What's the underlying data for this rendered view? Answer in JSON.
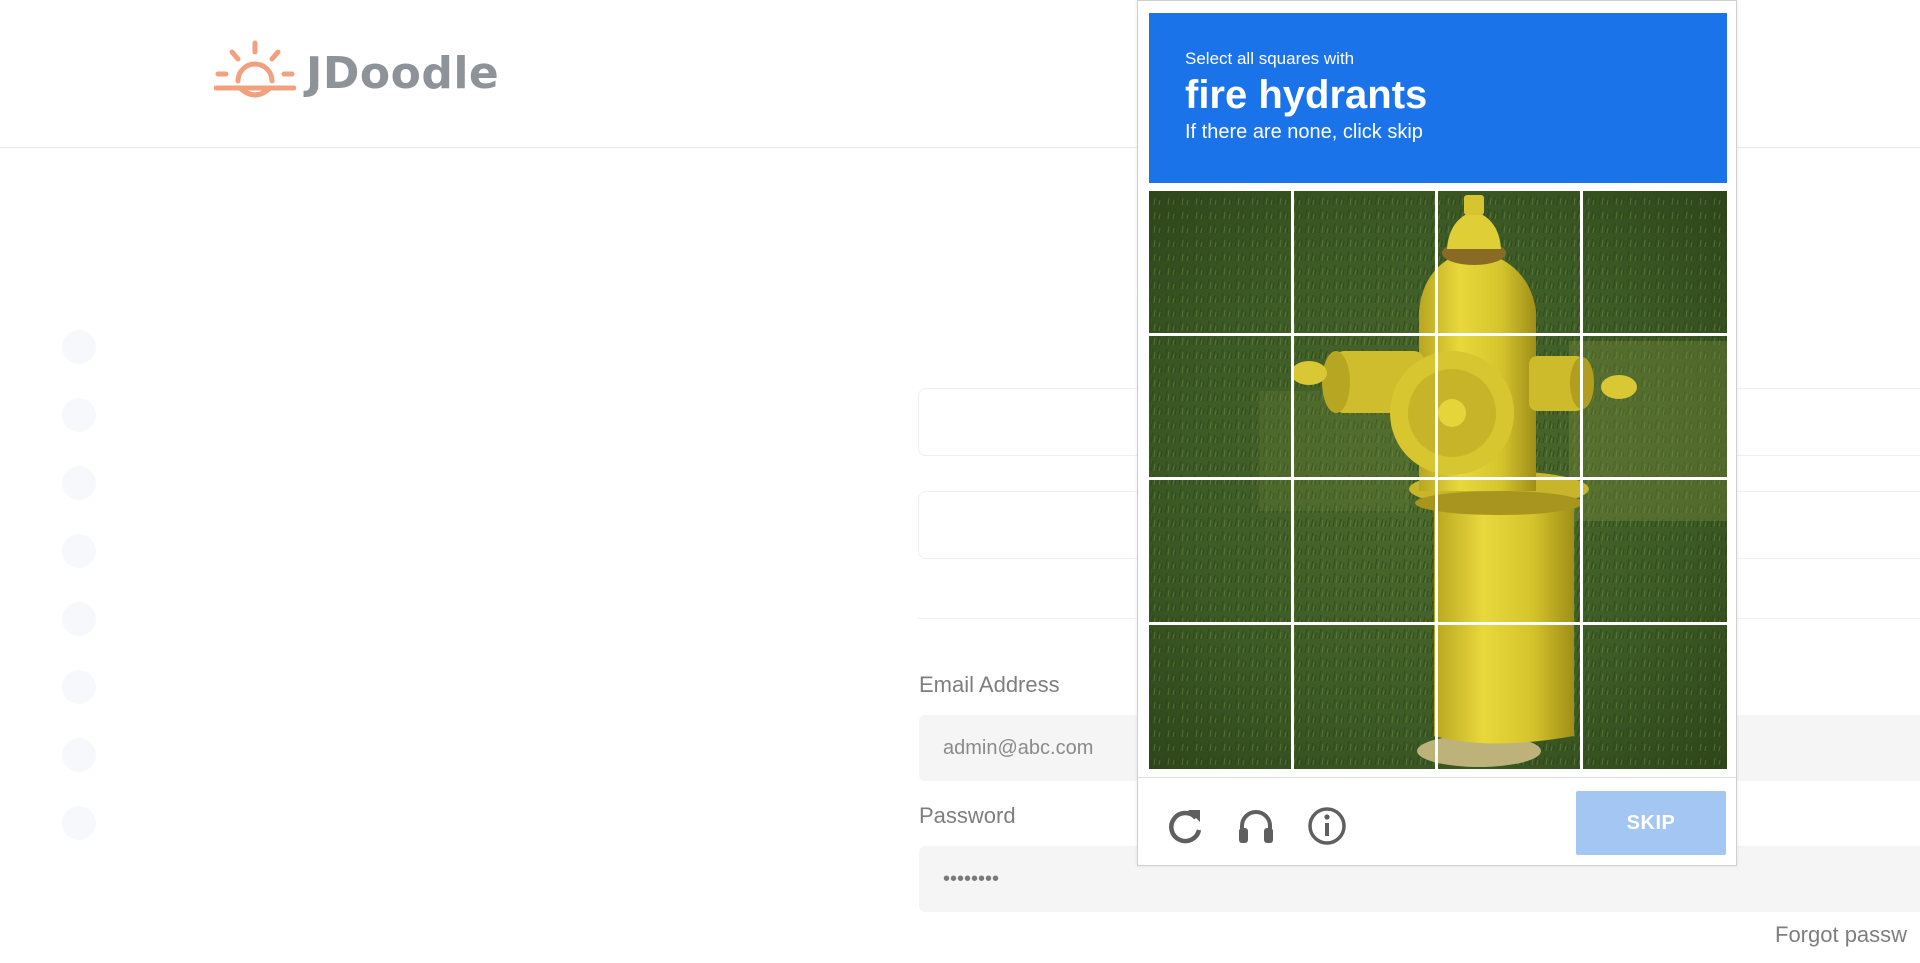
{
  "brand": {
    "name": "JDoodle"
  },
  "login": {
    "email_label": "Email Address",
    "email_placeholder": "admin@abc.com",
    "password_label": "Password",
    "password_value": "••••••••",
    "forgot_label": "Forgot passw"
  },
  "captcha": {
    "instruction": "Select all squares with",
    "target": "fire hydrants",
    "hint": "If there are none, click skip",
    "grid_rows": 4,
    "grid_cols": 4,
    "skip_label": "SKIP",
    "icons": [
      "reload-icon",
      "audio-challenge-icon",
      "info-icon"
    ],
    "header_color": "#1a73e8"
  }
}
